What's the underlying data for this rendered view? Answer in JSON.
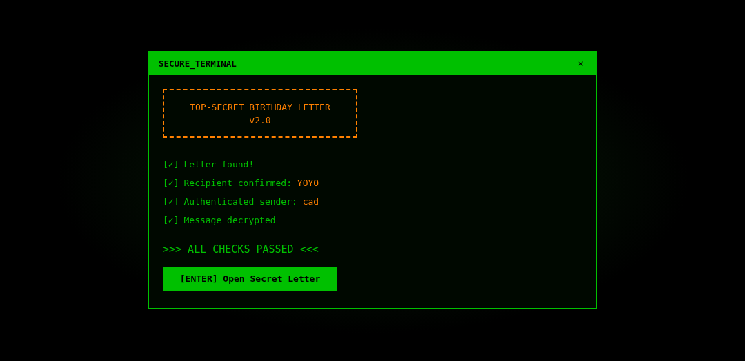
{
  "window": {
    "title": "SECURE_TERMINAL",
    "close": "×"
  },
  "banner": {
    "title": "TOP-SECRET BIRTHDAY LETTER",
    "version": "v2.0"
  },
  "checks": [
    {
      "mark": "[✓]",
      "checked": true,
      "label": "Letter found!"
    },
    {
      "mark": "[✓]",
      "checked": true,
      "label": "Recipient confirmed: ",
      "value": "YOYO"
    },
    {
      "mark": "[✓]",
      "checked": true,
      "label": "Authenticated sender: ",
      "value": "cad"
    },
    {
      "mark": "[✓]",
      "checked": true,
      "label": "Message decrypted"
    }
  ],
  "status": ">>> ALL CHECKS PASSED <<<",
  "button": "[ENTER] Open Secret Letter"
}
